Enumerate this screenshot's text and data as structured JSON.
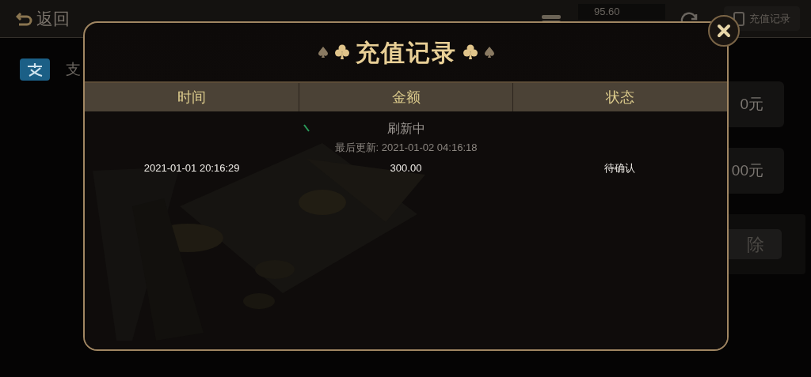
{
  "background": {
    "back_button": "返回",
    "balance": "95.60",
    "records_button": "充值记录",
    "payment_method": "支",
    "amount_options": [
      "0元",
      "00元"
    ],
    "clear_button": "除"
  },
  "dialog": {
    "title": "充值记录",
    "columns": [
      "时间",
      "金额",
      "状态"
    ],
    "refresh_status": "刷新中",
    "last_updated": "最后更新: 2021-01-02 04:16:18",
    "rows": [
      {
        "time": "2021-01-01 20:16:29",
        "amount": "300.00",
        "status": "待确认"
      }
    ]
  }
}
